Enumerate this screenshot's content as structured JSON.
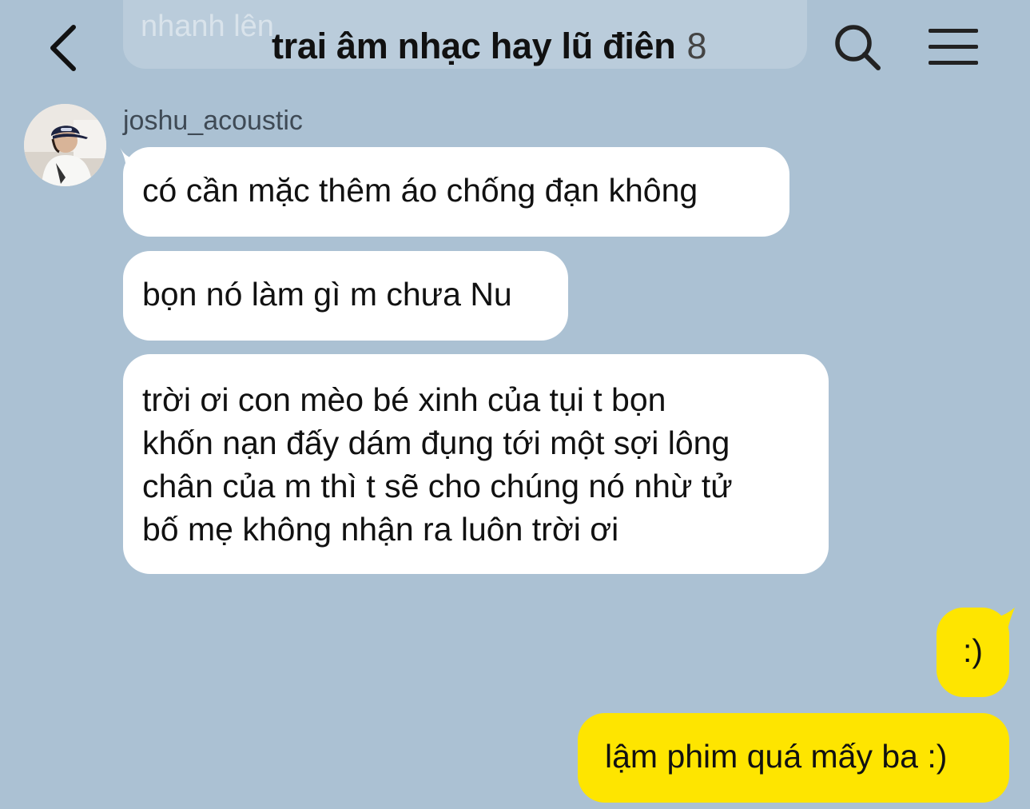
{
  "header": {
    "previous_message_fragment": "nhanh lên",
    "title": "trai âm nhạc hay lũ điên",
    "member_count": "8",
    "back_icon": "chevron-left-icon",
    "search_icon": "search-icon",
    "menu_icon": "hamburger-menu-icon"
  },
  "conversation": {
    "sender": {
      "name": "joshu_acoustic",
      "avatar": "user-avatar-photo"
    },
    "incoming_messages": [
      {
        "text": "có cần mặc thêm áo chống đạn không"
      },
      {
        "text": "bọn nó làm gì m chưa Nu"
      },
      {
        "text": "trời ơi con mèo bé xinh của tụi t bọn\nkhốn nạn đấy dám đụng tới một sợi lông\nchân của m thì t sẽ cho chúng nó nhừ tử\nbố mẹ không nhận ra luôn trời ơi"
      }
    ],
    "outgoing_messages": [
      {
        "text": ":)"
      },
      {
        "text": "lậm phim quá mấy ba :)"
      }
    ]
  },
  "colors": {
    "background": "#abc1d3",
    "incoming_bubble": "#ffffff",
    "outgoing_bubble": "#fee500",
    "text": "#111111",
    "sender_name": "#3f4a55"
  }
}
